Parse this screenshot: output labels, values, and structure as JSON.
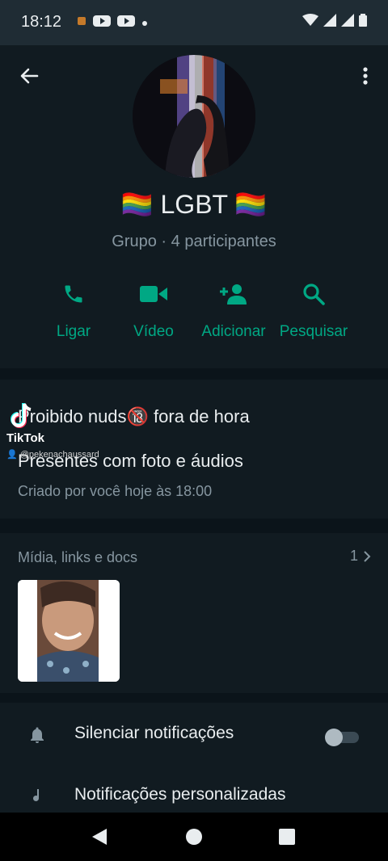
{
  "status_bar": {
    "time": "18:12"
  },
  "group": {
    "name": "🏳️‍🌈 LGBT 🏳️‍🌈",
    "subtitle": "Grupo · 4 participantes"
  },
  "actions": [
    {
      "label": "Ligar",
      "icon": "phone-icon"
    },
    {
      "label": "Vídeo",
      "icon": "video-icon"
    },
    {
      "label": "Adicionar",
      "icon": "add-person-icon"
    },
    {
      "label": "Pesquisar",
      "icon": "search-icon"
    }
  ],
  "description": {
    "line1": "Proibido nuds🔞 fora de hora",
    "line2": "Presentes com foto e áudios",
    "created": "Criado por você hoje às 18:00"
  },
  "watermark": {
    "brand": "TikTok",
    "user": "@pekenachaussard"
  },
  "media": {
    "title": "Mídia, links e docs",
    "count": "1"
  },
  "settings": [
    {
      "label": "Silenciar notificações",
      "icon": "bell-icon",
      "toggle_on": false
    },
    {
      "label": "Notificações personalizadas",
      "icon": "music-note-icon"
    }
  ],
  "colors": {
    "accent": "#00a884",
    "background": "#0b141a",
    "panel": "#111b21",
    "muted": "#8696a0"
  }
}
